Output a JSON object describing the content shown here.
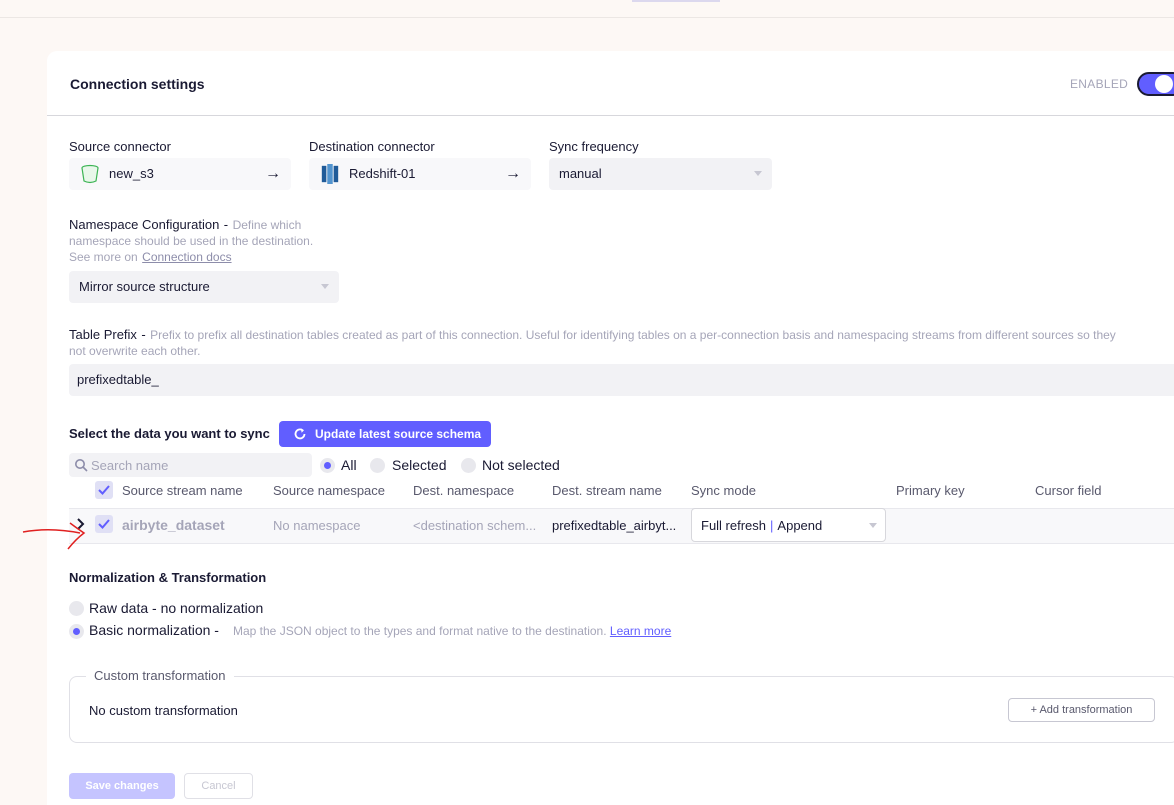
{
  "header": {
    "title": "Connection settings",
    "enabled_label": "ENABLED",
    "enabled": true
  },
  "source": {
    "label": "Source connector",
    "name": "new_s3",
    "icon": "bucket-icon"
  },
  "destination": {
    "label": "Destination connector",
    "name": "Redshift-01",
    "icon": "redshift-icon"
  },
  "sync_frequency": {
    "label": "Sync frequency",
    "value": "manual"
  },
  "namespace": {
    "label": "Namespace Configuration",
    "dash": "-",
    "hint_line1": "Define which",
    "hint_line2": "namespace should be used in the destination.",
    "see_more": "See more on",
    "link": "Connection docs",
    "value": "Mirror source structure"
  },
  "prefix": {
    "label": "Table Prefix",
    "dash": "-",
    "hint_line1": "Prefix to prefix all destination tables created as part of this connection. Useful for identifying tables on a per-connection basis and namespacing streams from different sources so they",
    "hint_line2": "not overwrite each other.",
    "value": "prefixedtable_"
  },
  "schema": {
    "title": "Select the data you want to sync",
    "update_button": "Update latest source schema",
    "search_placeholder": "Search name",
    "filters": [
      "All",
      "Selected",
      "Not selected"
    ],
    "selected_filter": "All",
    "columns": [
      "Source stream name",
      "Source namespace",
      "Dest. namespace",
      "Dest. stream name",
      "Sync mode",
      "Primary key",
      "Cursor field"
    ],
    "rows": [
      {
        "stream": "airbyte_dataset",
        "source_namespace": "No namespace",
        "dest_namespace": "<destination schem...",
        "dest_stream": "prefixedtable_airbyt...",
        "sync_mode_a": "Full refresh",
        "sync_mode_sep": "|",
        "sync_mode_b": "Append",
        "primary_key": "",
        "cursor_field": ""
      }
    ]
  },
  "normalization": {
    "title": "Normalization & Transformation",
    "options": [
      {
        "label": "Raw data - no normalization",
        "selected": false
      },
      {
        "label": "Basic normalization -",
        "selected": true,
        "hint": "Map the JSON object to the types and format native to the destination.",
        "link": "Learn more"
      }
    ]
  },
  "custom_transformation": {
    "legend": "Custom transformation",
    "empty_text": "No custom transformation",
    "add_button": "+ Add transformation"
  },
  "footer": {
    "save": "Save changes",
    "cancel": "Cancel"
  },
  "colors": {
    "accent": "#615eff",
    "annotation": "#e02020"
  }
}
